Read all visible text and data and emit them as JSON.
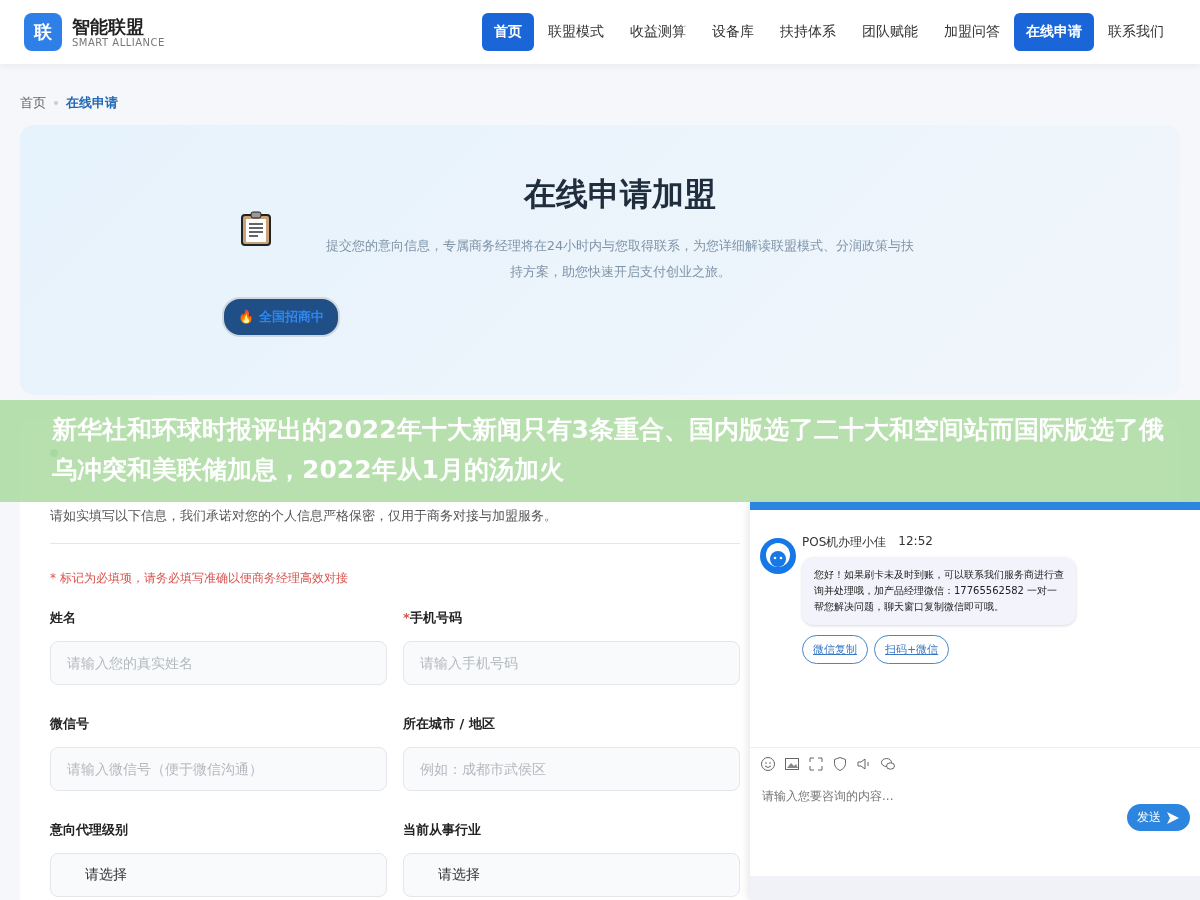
{
  "brand": {
    "logo_char": "联",
    "name": "智能联盟",
    "tagline": "SMART ALLIANCE"
  },
  "nav": [
    {
      "label": "首页",
      "selected": true
    },
    {
      "label": "联盟模式",
      "selected": false
    },
    {
      "label": "收益测算",
      "selected": false
    },
    {
      "label": "设备库",
      "selected": false
    },
    {
      "label": "扶持体系",
      "selected": false
    },
    {
      "label": "团队赋能",
      "selected": false
    },
    {
      "label": "加盟问答",
      "selected": false
    },
    {
      "label": "在线申请",
      "selected": true
    },
    {
      "label": "联系我们",
      "selected": false
    }
  ],
  "breadcrumb": [
    {
      "label": "首页",
      "current": false
    },
    {
      "label": "在线申请",
      "current": true
    }
  ],
  "hero": {
    "title": "在线申请加盟",
    "description": "提交您的意向信息，专属商务经理将在24小时内与您取得联系，为您详细解读联盟模式、分润政策与扶持方案，助您快速开启支付创业之旅。",
    "badge": "🔥 全国招商中"
  },
  "form": {
    "intro": "请如实填写以下信息，我们承诺对您的个人信息严格保密，仅用于商务对接与加盟服务。",
    "required_mark": "*",
    "required_note": "* 标记为必填项，请务必填写准确以便商务经理高效对接",
    "fields": [
      {
        "label": "姓名",
        "required": false,
        "kind": "input",
        "placeholder": "请输入您的真实姓名"
      },
      {
        "label": "手机号码",
        "required": true,
        "kind": "input",
        "placeholder": "请输入手机号码"
      },
      {
        "label": "微信号",
        "required": false,
        "kind": "input",
        "placeholder": "请输入微信号（便于微信沟通）"
      },
      {
        "label": "所在城市 / 地区",
        "required": false,
        "kind": "input",
        "placeholder": "例如：成都市武侯区"
      },
      {
        "label": "意向代理级别",
        "required": false,
        "kind": "select",
        "value": "请选择"
      },
      {
        "label": "当前从事行业",
        "required": false,
        "kind": "select",
        "value": "请选择"
      }
    ]
  },
  "overlay_banner": "新华社和环球时报评出的2022年十大新闻只有3条重合、国内版选了二十大和空间站而国际版选了俄乌冲突和美联储加息，2022年从1月的汤加火",
  "chat": {
    "agent": "POS机办理小佳",
    "time": "12:52",
    "message": "您好！如果刷卡未及时到账，可以联系我们服务商进行查询并处理哦，加产品经理微信：17765562582 一对一帮您解决问题，聊天窗口复制微信即可哦。",
    "actions": [
      "微信复制",
      "扫码+微信"
    ],
    "input_placeholder": "请输入您要咨询的内容...",
    "send": "发送"
  }
}
